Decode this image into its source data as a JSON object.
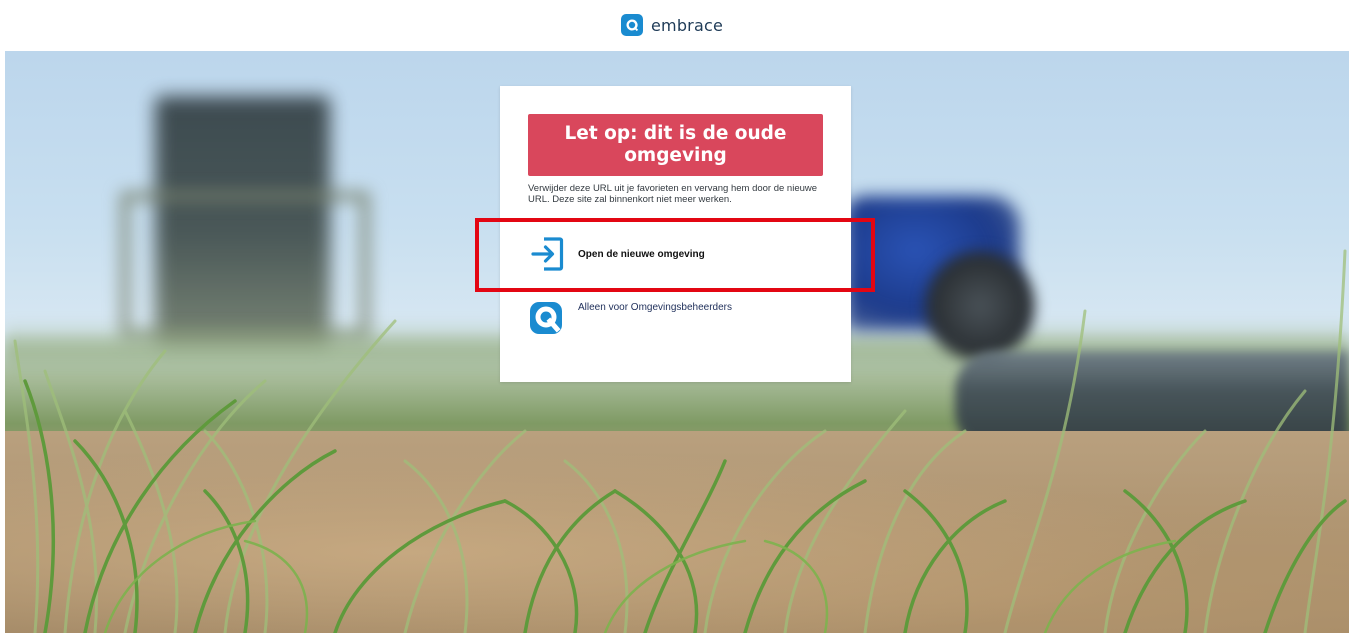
{
  "header": {
    "brand_name": "embrace",
    "logo_icon": "embrace-logo-icon"
  },
  "background": {
    "description_icon": "field-photo"
  },
  "notice": {
    "warning_title": "Let op: dit is de oude omgeving",
    "warning_color": "#d9475c",
    "description": "Verwijder deze URL uit je favorieten en vervang hem door de nieuwe URL. Deze site zal binnenkort niet meer werken."
  },
  "options": {
    "new_environment": {
      "label": "Open de nieuwe omgeving",
      "icon": "sign-in-arrow-icon"
    },
    "administrators": {
      "label": "Alleen voor Omgevingsbeheerders",
      "icon": "q-logo-icon"
    }
  },
  "colors": {
    "brand_blue": "#1a8bd0",
    "highlight_red": "#e30613"
  }
}
